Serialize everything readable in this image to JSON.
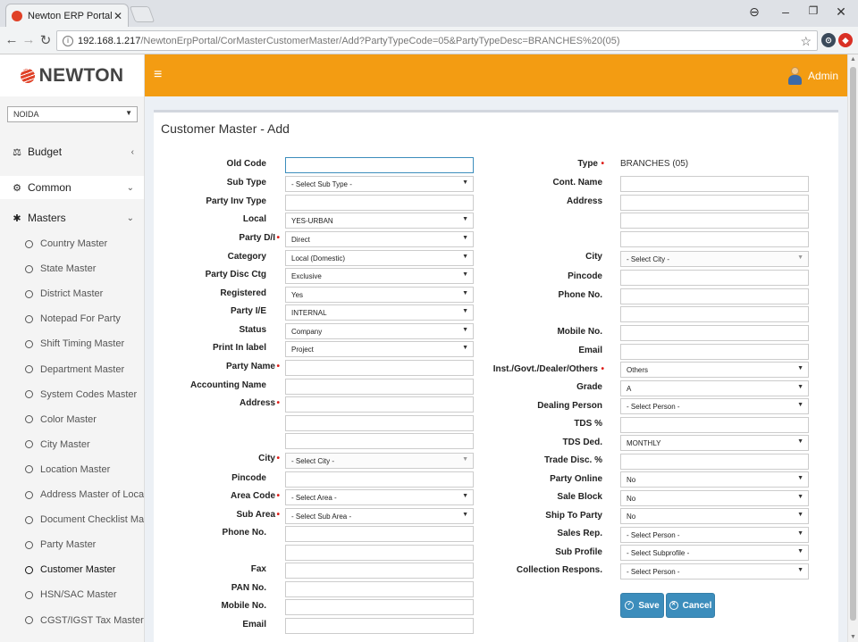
{
  "browser": {
    "tab_title": "Newton ERP Portal | Custo",
    "url_host": "192.168.1.217",
    "url_path": "/NewtonErpPortal/CorMasterCustomerMaster/Add?PartyTypeCode=05&PartyTypeDesc=BRANCHES%20(05)",
    "info_icon": "i"
  },
  "app": {
    "logo": "NEWTON",
    "user": "Admin",
    "accent": "#f39c12"
  },
  "sidebar": {
    "branch": "NOIDA",
    "budget": "Budget",
    "common": "Common",
    "masters": "Masters",
    "items": [
      "Country Master",
      "State Master",
      "District Master",
      "Notepad For Party",
      "Shift Timing Master",
      "Department Master",
      "System Codes Master",
      "Color Master",
      "City Master",
      "Location Master",
      "Address Master of Loca..",
      "Document Checklist Mas..",
      "Party Master",
      "Customer Master",
      "HSN/SAC Master",
      "CGST/IGST Tax Master"
    ],
    "active_item": "Customer Master"
  },
  "page": {
    "title": "Customer Master - Add"
  },
  "left": {
    "old_code": "Old Code",
    "sub_type": "Sub Type",
    "sub_type_val": "- Select Sub Type -",
    "party_inv_type": "Party Inv Type",
    "local": "Local",
    "local_val": "YES-URBAN",
    "party_di": "Party D/I",
    "party_di_val": "Direct",
    "category": "Category",
    "category_val": "Local (Domestic)",
    "party_disc_ctg": "Party Disc Ctg",
    "party_disc_ctg_val": "Exclusive",
    "registered": "Registered",
    "registered_val": "Yes",
    "party_ie": "Party I/E",
    "party_ie_val": "INTERNAL",
    "status": "Status",
    "status_val": "Company",
    "print_in_label": "Print In label",
    "print_in_label_val": "Project",
    "party_name": "Party Name",
    "accounting_name": "Accounting Name",
    "address": "Address",
    "city": "City",
    "city_val": "- Select City -",
    "pincode": "Pincode",
    "area_code": "Area Code",
    "area_code_val": "- Select Area -",
    "sub_area": "Sub Area",
    "sub_area_val": "- Select Sub Area -",
    "phone_no": "Phone No.",
    "fax": "Fax",
    "pan_no": "PAN No.",
    "mobile_no": "Mobile No.",
    "email": "Email"
  },
  "right": {
    "type": "Type",
    "type_val": "BRANCHES (05)",
    "cont_name": "Cont. Name",
    "address": "Address",
    "city": "City",
    "city_val": "- Select City -",
    "pincode": "Pincode",
    "phone_no": "Phone No.",
    "mobile_no": "Mobile No.",
    "email": "Email",
    "inst": "Inst./Govt./Dealer/Others",
    "inst_val": "Others",
    "grade": "Grade",
    "grade_val": "A",
    "dealing_person": "Dealing Person",
    "dealing_person_val": "- Select Person -",
    "tds_pct": "TDS %",
    "tds_ded": "TDS Ded.",
    "tds_ded_val": "MONTHLY",
    "trade_disc": "Trade Disc. %",
    "party_online": "Party Online",
    "party_online_val": "No",
    "sale_block": "Sale Block",
    "sale_block_val": "No",
    "ship_to_party": "Ship To Party",
    "ship_to_party_val": "No",
    "sales_rep": "Sales Rep.",
    "sales_rep_val": "- Select Person -",
    "sub_profile": "Sub Profile",
    "sub_profile_val": "- Select Subprofile -",
    "collection_respons": "Collection Respons.",
    "collection_respons_val": "- Select Person -"
  },
  "buttons": {
    "save": "Save",
    "cancel": "Cancel"
  }
}
